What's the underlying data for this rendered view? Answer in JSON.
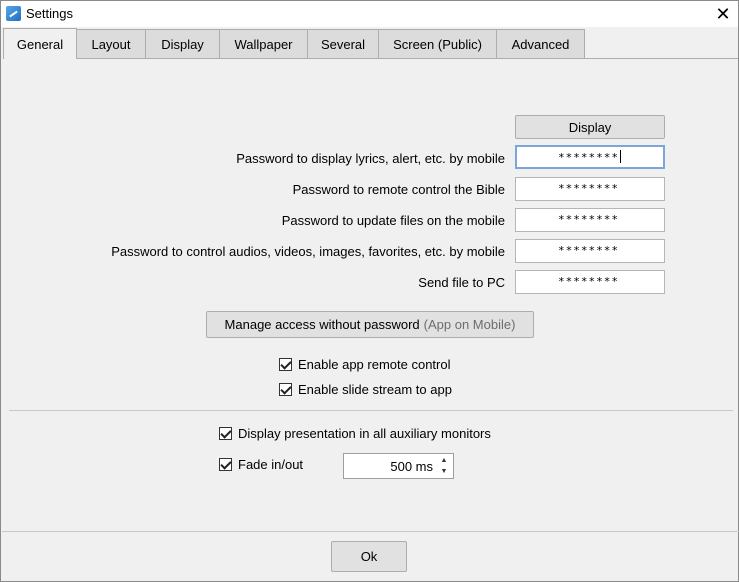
{
  "window": {
    "title": "Settings"
  },
  "tabs": [
    {
      "label": "General",
      "active": true
    },
    {
      "label": "Layout"
    },
    {
      "label": "Display"
    },
    {
      "label": "Wallpaper"
    },
    {
      "label": "Several"
    },
    {
      "label": "Screen (Public)"
    },
    {
      "label": "Advanced"
    }
  ],
  "general": {
    "display_button": "Display",
    "passwords": [
      {
        "label": "Password to display lyrics, alert, etc. by mobile",
        "value": "********"
      },
      {
        "label": "Password to remote control the Bible",
        "value": "********"
      },
      {
        "label": "Password to update files on the mobile",
        "value": "********"
      },
      {
        "label": "Password to control audios, videos, images, favorites, etc. by mobile",
        "value": "********"
      },
      {
        "label": "Send file to PC",
        "value": "********"
      }
    ],
    "manage_access": {
      "label": "Manage access without password",
      "hint": "(App on Mobile)"
    },
    "checkboxes": {
      "remote_control": {
        "label": "Enable app remote control",
        "checked": true
      },
      "slide_stream": {
        "label": "Enable slide stream to app",
        "checked": true
      },
      "all_monitors": {
        "label": "Display presentation in all auxiliary monitors",
        "checked": true
      },
      "fade": {
        "label": "Fade in/out",
        "checked": true
      }
    },
    "fade_duration": "500 ms"
  },
  "footer": {
    "ok_label": "Ok"
  },
  "icons": {
    "close": "close-icon",
    "app": "app-icon",
    "spin_up": "chevron-up-icon",
    "spin_down": "chevron-down-icon"
  }
}
